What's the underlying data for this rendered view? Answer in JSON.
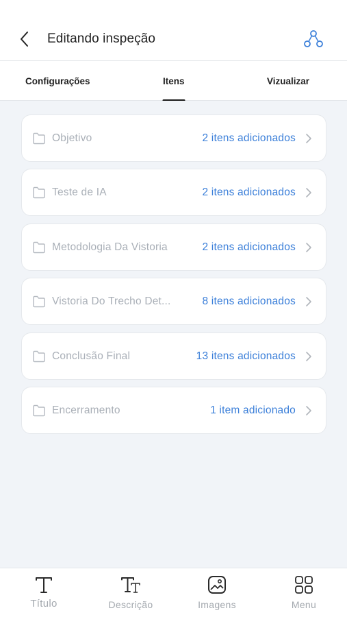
{
  "header": {
    "title": "Editando inspeção",
    "back_icon": "chevron-left-icon",
    "share_icon": "share-nodes-icon"
  },
  "tabs": [
    {
      "label": "Configurações",
      "active": false
    },
    {
      "label": "Itens",
      "active": true
    },
    {
      "label": "Vizualizar",
      "active": false
    }
  ],
  "items": [
    {
      "label": "Objetivo",
      "count": "2 itens adicionados"
    },
    {
      "label": "Teste de IA",
      "count": "2 itens adicionados"
    },
    {
      "label": "Metodologia Da Vistoria",
      "count": "2 itens adicionados"
    },
    {
      "label": "Vistoria Do Trecho Det...",
      "count": "8 itens adicionados"
    },
    {
      "label": "Conclusão Final",
      "count": "13 itens adicionados"
    },
    {
      "label": "Encerramento",
      "count": "1 item adicionado"
    }
  ],
  "bottom_bar": [
    {
      "label": "Título",
      "icon": "title-text-icon"
    },
    {
      "label": "Descrição",
      "icon": "description-text-icon"
    },
    {
      "label": "Imagens",
      "icon": "image-icon"
    },
    {
      "label": "Menu",
      "icon": "grid-menu-icon"
    }
  ],
  "colors": {
    "accent": "#3b7fd9",
    "muted_text": "#a9afb7",
    "background": "#f1f4f8",
    "card": "#ffffff",
    "share_icon": "#3b7fd9"
  }
}
